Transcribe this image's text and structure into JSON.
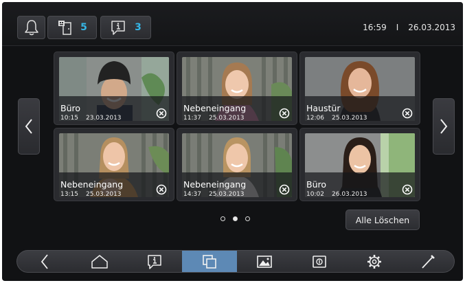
{
  "header": {
    "history_count": "5",
    "messages_count": "3",
    "time": "16:59",
    "separator": "I",
    "date": "26.03.2013"
  },
  "gallery": {
    "cards": [
      {
        "name": "Büro",
        "time": "10:15",
        "date": "23.03.2013"
      },
      {
        "name": "Nebeneingang",
        "time": "11:37",
        "date": "25.03.2013"
      },
      {
        "name": "Haustür",
        "time": "12:06",
        "date": "25.03.2013"
      },
      {
        "name": "Nebeneingang",
        "time": "13:15",
        "date": "25.03.2013"
      },
      {
        "name": "Nebeneingang",
        "time": "14:37",
        "date": "25.03.2013"
      },
      {
        "name": "Büro",
        "time": "10:02",
        "date": "26.03.2013"
      }
    ],
    "page_current": 2,
    "page_total": 3,
    "clear_label": "Alle Löschen"
  },
  "nav": {
    "items": [
      "back-icon",
      "home-icon",
      "info-icon",
      "gallery-icon",
      "picture-icon",
      "intercom-icon",
      "gear-icon",
      "tools-icon"
    ],
    "active": "gallery-icon"
  },
  "colors": {
    "accent": "#35b6e6",
    "nav_active": "#5d89b5",
    "background": "#111214"
  }
}
